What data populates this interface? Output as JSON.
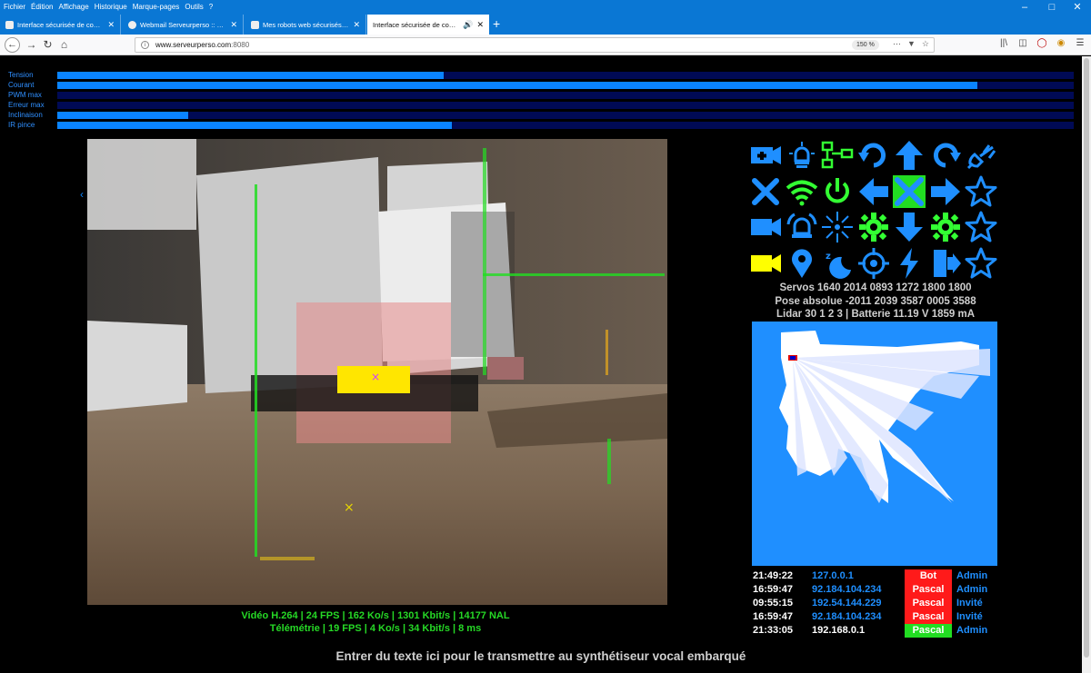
{
  "menu": [
    "Fichier",
    "Édition",
    "Affichage",
    "Historique",
    "Marque-pages",
    "Outils",
    "?"
  ],
  "tabs": [
    {
      "title": "Interface sécurisée de comman",
      "active": false
    },
    {
      "title": "Webmail Serveurperso :: Boîte",
      "active": false
    },
    {
      "title": "Mes robots web sécurisés avec",
      "active": false
    },
    {
      "title": "Interface sécurisée de comman",
      "active": true
    }
  ],
  "url": {
    "host": "www.serveurperso.com",
    "port": ":8080",
    "zoom": "150 %"
  },
  "gauges": [
    {
      "label": "Tension",
      "value": 0.38
    },
    {
      "label": "Courant",
      "value": 0.905
    },
    {
      "label": "PWM max",
      "value": 0
    },
    {
      "label": "Erreur max",
      "value": 0
    },
    {
      "label": "Inclinaison",
      "value": 0.129
    },
    {
      "label": "IR pince",
      "value": 0.388
    }
  ],
  "video_info": {
    "line1": "Vidéo H.264 | 24 FPS | 162 Ko/s | 1301 Kbit/s | 14177 NAL",
    "line2": "Télémétrie | 19 FPS | 4 Ko/s | 34 Kbit/s | 8 ms"
  },
  "icons": [
    {
      "name": "plus-camera-icon",
      "color": "#1f8fff"
    },
    {
      "name": "light-bulb-icon",
      "color": "#1f8fff"
    },
    {
      "name": "network-icon",
      "color": "#33ff33"
    },
    {
      "name": "rotate-left-icon",
      "color": "#1f8fff"
    },
    {
      "name": "arrow-up-icon",
      "color": "#1f8fff"
    },
    {
      "name": "rotate-right-icon",
      "color": "#1f8fff"
    },
    {
      "name": "plug-icon",
      "color": "#1f8fff"
    },
    {
      "name": "close-icon",
      "color": "#1f8fff"
    },
    {
      "name": "wifi-icon",
      "color": "#33ff33"
    },
    {
      "name": "power-icon",
      "color": "#33ff33"
    },
    {
      "name": "arrow-left-icon",
      "color": "#1f8fff"
    },
    {
      "name": "stop-icon",
      "color": "#1f8fff"
    },
    {
      "name": "arrow-right-icon",
      "color": "#1f8fff"
    },
    {
      "name": "star-icon",
      "color": "#1f8fff"
    },
    {
      "name": "video-camera-icon",
      "color": "#1f8fff"
    },
    {
      "name": "alarm-icon",
      "color": "#1f8fff"
    },
    {
      "name": "laser-icon",
      "color": "#1f8fff"
    },
    {
      "name": "gear-icon",
      "color": "#33ff33"
    },
    {
      "name": "arrow-down-icon",
      "color": "#1f8fff"
    },
    {
      "name": "gear-icon",
      "color": "#33ff33"
    },
    {
      "name": "star-icon",
      "color": "#1f8fff"
    },
    {
      "name": "video-camera-icon",
      "color": "#ffff00"
    },
    {
      "name": "location-pin-icon",
      "color": "#1f8fff"
    },
    {
      "name": "sleep-icon",
      "color": "#1f8fff"
    },
    {
      "name": "target-icon",
      "color": "#1f8fff"
    },
    {
      "name": "lightning-icon",
      "color": "#1f8fff"
    },
    {
      "name": "exit-icon",
      "color": "#1f8fff"
    },
    {
      "name": "star-icon",
      "color": "#1f8fff"
    }
  ],
  "telemetry": {
    "servos": "Servos 1640 2014 0893 1272 1800 1800",
    "pose": "Pose absolue -2011 2039 3587 0005 3588",
    "lidar": "Lidar 30 1 2 3 | Batterie 11.19 V 1859 mA"
  },
  "connections": [
    {
      "time": "21:49:22",
      "ip": "127.0.0.1",
      "ip_color": "#1f8fff",
      "user": "Bot",
      "user_bg": "#ff1a1a",
      "role": "Admin",
      "role_color": "#1f8fff"
    },
    {
      "time": "16:59:47",
      "ip": "92.184.104.234",
      "ip_color": "#1f8fff",
      "user": "Pascal",
      "user_bg": "#ff1a1a",
      "role": "Admin",
      "role_color": "#1f8fff"
    },
    {
      "time": "09:55:15",
      "ip": "192.54.144.229",
      "ip_color": "#1f8fff",
      "user": "Pascal",
      "user_bg": "#ff1a1a",
      "role": "Invité",
      "role_color": "#1f8fff"
    },
    {
      "time": "16:59:47",
      "ip": "92.184.104.234",
      "ip_color": "#1f8fff",
      "user": "Pascal",
      "user_bg": "#ff1a1a",
      "role": "Invité",
      "role_color": "#1f8fff"
    },
    {
      "time": "21:33:05",
      "ip": "192.168.0.1",
      "ip_color": "#ffffff",
      "user": "Pascal",
      "user_bg": "#22dd22",
      "role": "Admin",
      "role_color": "#1f8fff"
    }
  ],
  "speech_hint": "Entrer du texte ici pour le transmettre au synthétiseur vocal embarqué"
}
